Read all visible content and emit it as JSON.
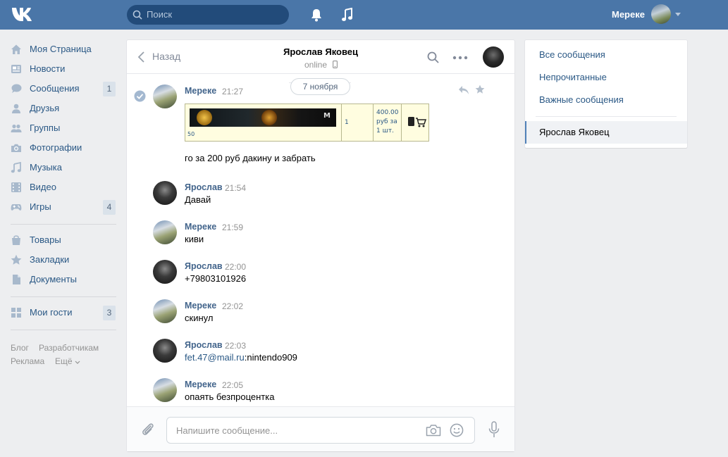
{
  "header": {
    "search_placeholder": "Поиск",
    "user_name": "Мереке"
  },
  "nav": {
    "items": [
      {
        "label": "Моя Страница",
        "icon": "home-icon"
      },
      {
        "label": "Новости",
        "icon": "news-icon"
      },
      {
        "label": "Сообщения",
        "icon": "messages-icon",
        "count": "1"
      },
      {
        "label": "Друзья",
        "icon": "friends-icon"
      },
      {
        "label": "Группы",
        "icon": "groups-icon"
      },
      {
        "label": "Фотографии",
        "icon": "photos-icon"
      },
      {
        "label": "Музыка",
        "icon": "music-icon"
      },
      {
        "label": "Видео",
        "icon": "video-icon"
      },
      {
        "label": "Игры",
        "icon": "games-icon",
        "count": "4"
      },
      {
        "label": "Товары",
        "icon": "market-icon"
      },
      {
        "label": "Закладки",
        "icon": "bookmarks-icon"
      },
      {
        "label": "Документы",
        "icon": "docs-icon"
      },
      {
        "label": "Мои гости",
        "icon": "apps-icon",
        "count": "3"
      }
    ],
    "footer": {
      "blog": "Блог",
      "dev": "Разработчикам",
      "ads": "Реклама",
      "more": "Ещё"
    }
  },
  "chat": {
    "back_label": "Назад",
    "peer_name": "Ярослав Яковец",
    "peer_status": "online",
    "date_separator": "7 ноября",
    "composer_placeholder": "Напишите сообщение...",
    "attachment": {
      "cell_qty": "1",
      "cell_price": [
        "400.00",
        "руб за",
        "1 шт."
      ],
      "cell_num": "50",
      "watermark": "M"
    },
    "messages": [
      {
        "author": "Мереке",
        "time": "21:27",
        "text": "го за 200 руб дакину и забрать"
      },
      {
        "author": "Ярослав",
        "time": "21:54",
        "text": "Давай"
      },
      {
        "author": "Мереке",
        "time": "21:59",
        "text": "киви"
      },
      {
        "author": "Ярослав",
        "time": "22:00",
        "text": "+79803101926"
      },
      {
        "author": "Мереке",
        "time": "22:02",
        "text": "скинул"
      },
      {
        "author": "Ярослав",
        "time": "22:03",
        "link": "fet.47@mail.ru",
        "text": ":nintendo909"
      },
      {
        "author": "Мереке",
        "time": "22:05",
        "text": "опаять безпроцентка"
      }
    ]
  },
  "right_panel": {
    "all": "Все сообщения",
    "unread": "Непрочитанные",
    "important": "Важные сообщения",
    "active_chat": "Ярослав Яковец"
  },
  "colors": {
    "brand": "#4a76a8",
    "link": "#2a5885",
    "author": "#42648b",
    "background": "#edeef0"
  }
}
